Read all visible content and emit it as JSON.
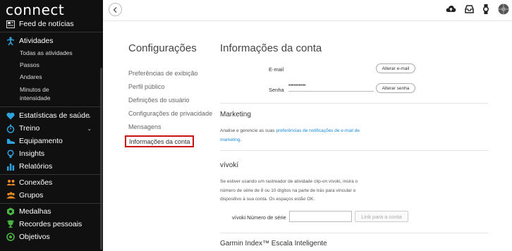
{
  "app": {
    "logo": "connect"
  },
  "sidebar": {
    "feed": "Feed de notícias",
    "activities": {
      "label": "Atividades",
      "sub": [
        "Todas as atividades",
        "Passos",
        "Andares",
        "Minutos de intensidade"
      ]
    },
    "items": [
      {
        "label": "Estatísticas de saúde",
        "color": "#2fa2e0",
        "icon": "heart-icon"
      },
      {
        "label": "Treino",
        "color": "#2fa2e0",
        "icon": "stopwatch-icon"
      },
      {
        "label": "Equipamento",
        "color": "#2fa2e0",
        "icon": "shoe-icon"
      },
      {
        "label": "Insights",
        "color": "#2fa2e0",
        "icon": "lightbulb-icon"
      },
      {
        "label": "Relatórios",
        "color": "#2fa2e0",
        "icon": "bar-chart-icon"
      },
      {
        "label": "Conexões",
        "color": "#f08a24",
        "icon": "people-icon"
      },
      {
        "label": "Grupos",
        "color": "#f08a24",
        "icon": "group-icon"
      },
      {
        "label": "Medalhas",
        "color": "#4bb543",
        "icon": "medal-icon"
      },
      {
        "label": "Recordes pessoais",
        "color": "#4bb543",
        "icon": "trophy-icon"
      },
      {
        "label": "Objetivos",
        "color": "#4bb543",
        "icon": "target-icon"
      }
    ]
  },
  "settings": {
    "title": "Configurações",
    "menu": [
      "Preferências de exibição",
      "Perfil público",
      "Definições do usuário",
      "Configurações de privacidade",
      "Mensagens",
      "Informações da conta"
    ]
  },
  "account": {
    "title": "Informações da conta",
    "email_label": "E-mail",
    "change_email": "Alterar e-mail",
    "password_label": "Senha",
    "password_value": "••••••••••",
    "change_password": "Alterar senha"
  },
  "marketing": {
    "title": "Marketing",
    "text_before": "Analise e gerencie as suas ",
    "link": "preferências de notificações de e-mail de marketing",
    "text_after": "."
  },
  "vivoki": {
    "title": "vívokí",
    "text": "Se estiver usando um rastreador de atividade clip-on vívoki, insira o número de série de 8 ou 10 dígitos na parte de trás para vincular o dispositivo à sua conta. Os espaços estão OK.",
    "serial_label": "vívoki Número de série",
    "link_button": "Link para a conta"
  },
  "garmin_index": {
    "title": "Garmin Index™ Escala Inteligente"
  },
  "colors": {
    "active_outline": "#cc1111",
    "link": "#1a8ad4",
    "sidebar_bg": "#101010"
  }
}
